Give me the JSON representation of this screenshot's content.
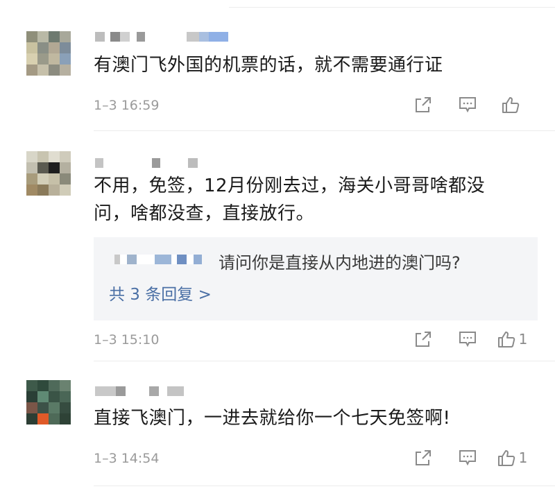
{
  "comments": [
    {
      "text": "有澳门飞外国的机票的话，就不需要通行证",
      "time": "1–3 16:59",
      "likes": ""
    },
    {
      "text_line1": "不用，免签，12月份刚去过，海关小哥哥啥都没",
      "text_line2": "问，啥都没查，直接放行。",
      "reply_preview": "请问你是直接从内地进的澳门吗?",
      "reply_more": "共 3 条回复 >",
      "time": "1–3 15:10",
      "likes": "1"
    },
    {
      "text": "直接飞澳门，一进去就给你一个七天免签啊!",
      "time": "1–3 14:54",
      "likes": "1"
    }
  ],
  "icons": {
    "share": "share-icon",
    "comment": "comment-icon",
    "like": "thumbs-up-icon"
  },
  "colors": {
    "link": "#4a6fa5",
    "meta": "#9a9a9a",
    "reply_bg": "#f4f5f7"
  }
}
